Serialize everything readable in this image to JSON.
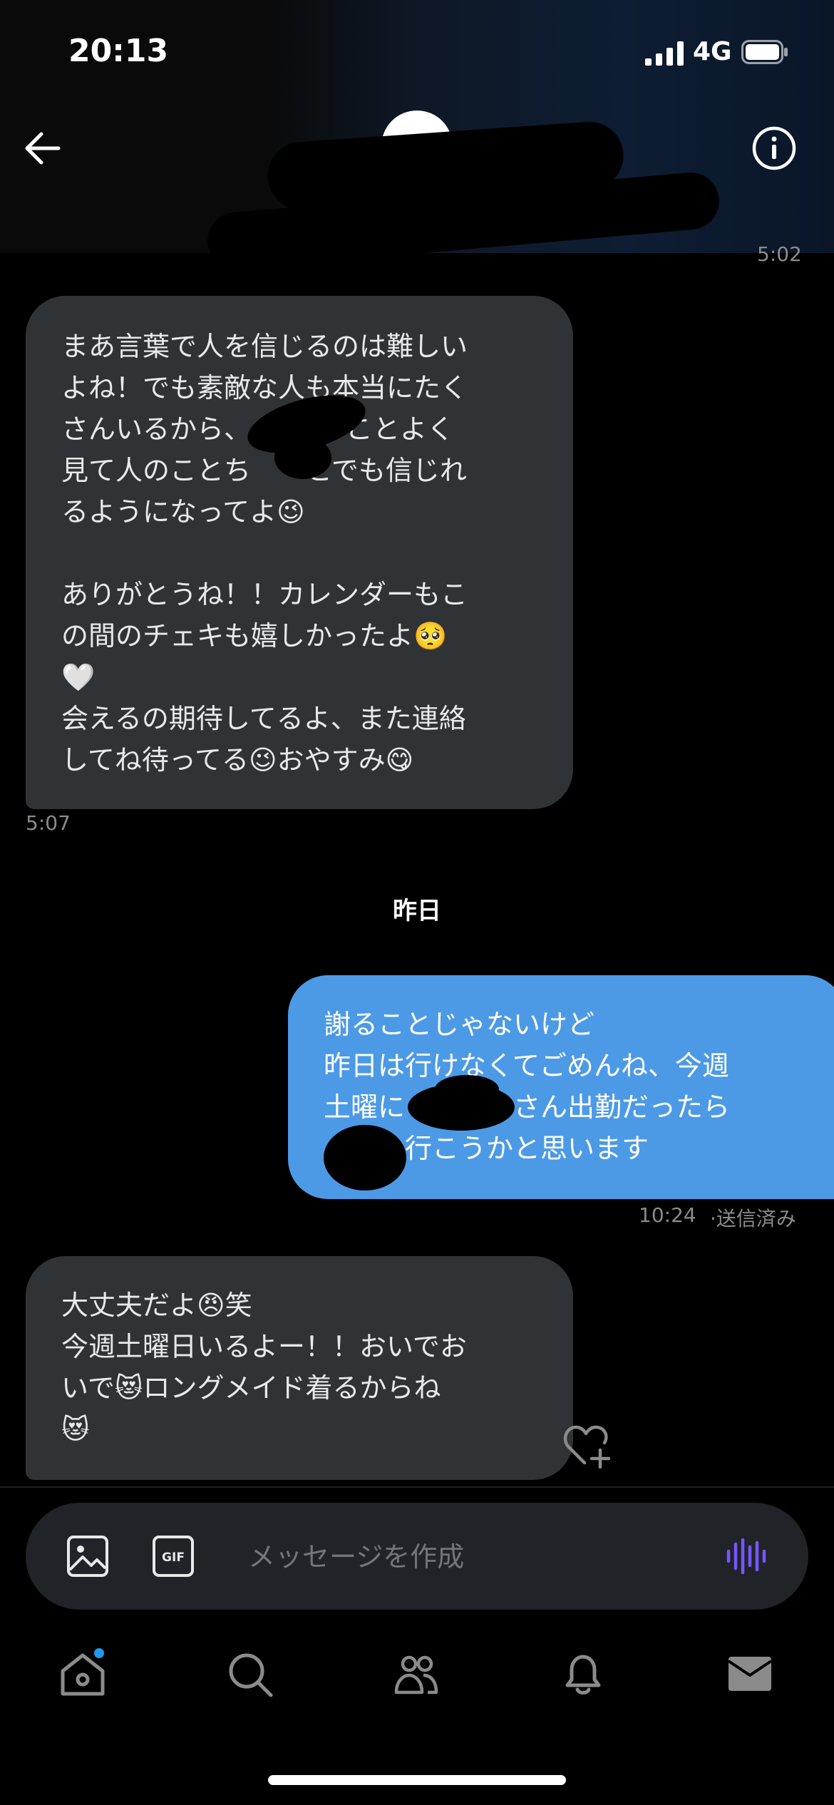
{
  "status": {
    "time": "20:13",
    "network": "4G"
  },
  "header": {
    "timestamp_partial": "5:02"
  },
  "messages": [
    {
      "direction": "received",
      "paragraphs": [
        [
          "まあ言葉で人を信じるのは難しい",
          "よね！でも素敵な人も本当にたく",
          "さんいるから、　　　のことよく",
          "見て人のことち　　とでも信じれ",
          "るようになってよ😉"
        ],
        [
          "ありがとうね！！カレンダーもこ",
          "の間のチェキも嬉しかったよ🥺",
          "🤍",
          "会えるの期待してるよ、また連絡",
          "してね待ってる😉おやすみ😋"
        ]
      ],
      "time": "5:07"
    },
    {
      "direction": "sent",
      "lines": [
        "謝ることじゃないけど",
        "昨日は行けなくてごめんね、今週",
        "土曜に　　　　さん出勤だったら",
        "　　　行こうかと思います"
      ],
      "time": "10:24",
      "status": "·送信済み"
    },
    {
      "direction": "received",
      "lines": [
        "大丈夫だよ😠笑",
        "今週土曜日いるよー！！おいでお",
        "いで😻ロングメイド着るからね",
        "😻"
      ]
    }
  ],
  "date_divider": "昨日",
  "composer": {
    "placeholder": "メッセージを作成"
  },
  "colors": {
    "sent_bubble": "#4c9ae6",
    "received_bubble": "#2f3336",
    "accent": "#1d9bf0",
    "voice": "#7856ff"
  },
  "icons": [
    "back-arrow-icon",
    "info-icon",
    "image-icon",
    "gif-icon",
    "voice-icon",
    "heart-plus-icon",
    "home-icon",
    "search-icon",
    "communities-icon",
    "bell-icon",
    "mail-icon"
  ]
}
